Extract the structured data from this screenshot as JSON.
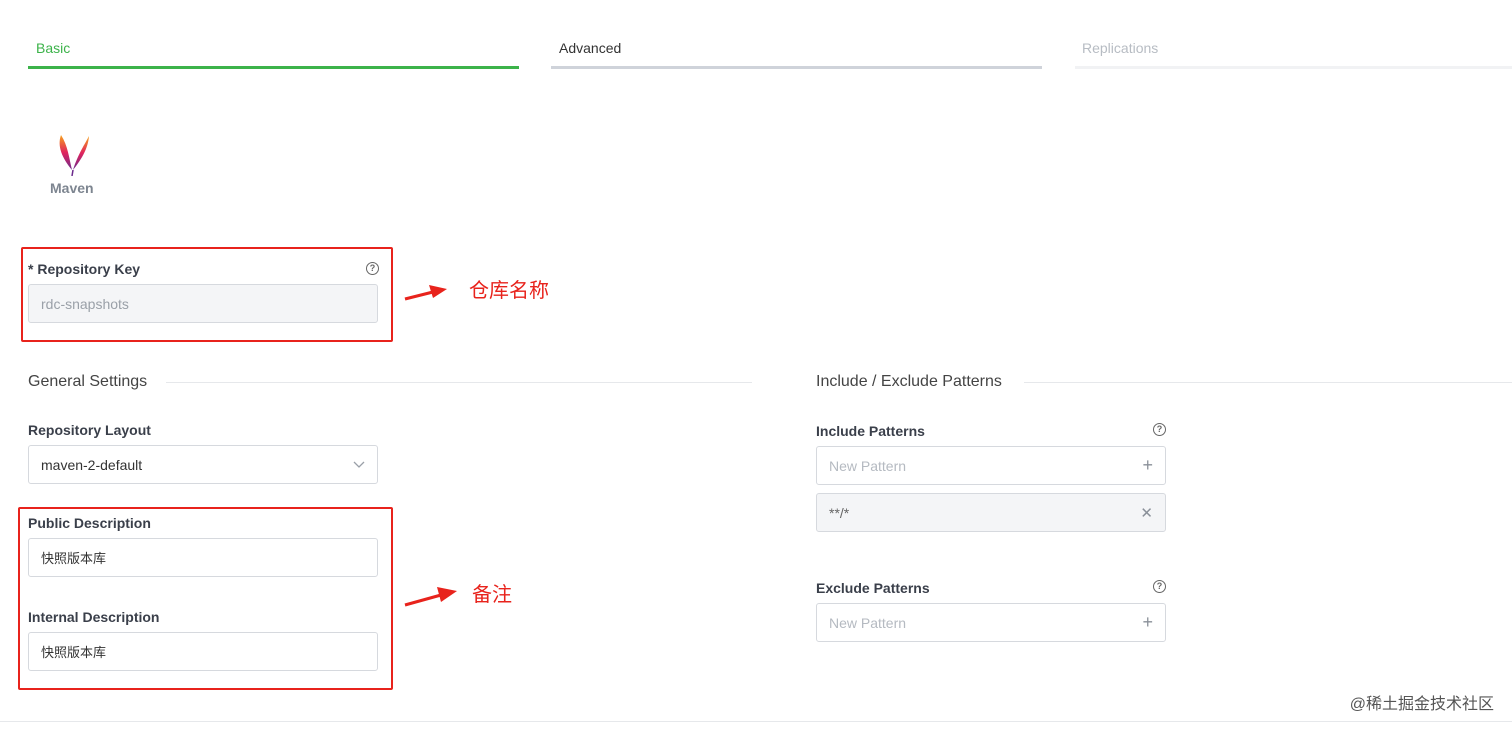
{
  "tabs": [
    {
      "label": "Basic",
      "state": "active"
    },
    {
      "label": "Advanced",
      "state": "inactive"
    },
    {
      "label": "Replications",
      "state": "disabled"
    }
  ],
  "colors": {
    "active_tab": "#3cb34a",
    "inactive_tab": "#cfd3da",
    "annotation": "#e8231c"
  },
  "package_type": {
    "icon": "maven-feather-icon",
    "label": "Maven"
  },
  "repository_key": {
    "label": "* Repository Key",
    "value": "rdc-snapshots"
  },
  "general_settings": {
    "title": "General Settings",
    "layout_label": "Repository Layout",
    "layout_value": "maven-2-default",
    "public_description_label": "Public Description",
    "public_description_value": "快照版本库",
    "internal_description_label": "Internal Description",
    "internal_description_value": "快照版本库"
  },
  "patterns": {
    "title": "Include / Exclude Patterns",
    "include_label": "Include Patterns",
    "include_placeholder": "New Pattern",
    "include_items": [
      "**/*"
    ],
    "exclude_label": "Exclude Patterns",
    "exclude_placeholder": "New Pattern"
  },
  "annotations": {
    "repo_name": "仓库名称",
    "remark": "备注"
  },
  "watermark": "@稀土掘金技术社区"
}
